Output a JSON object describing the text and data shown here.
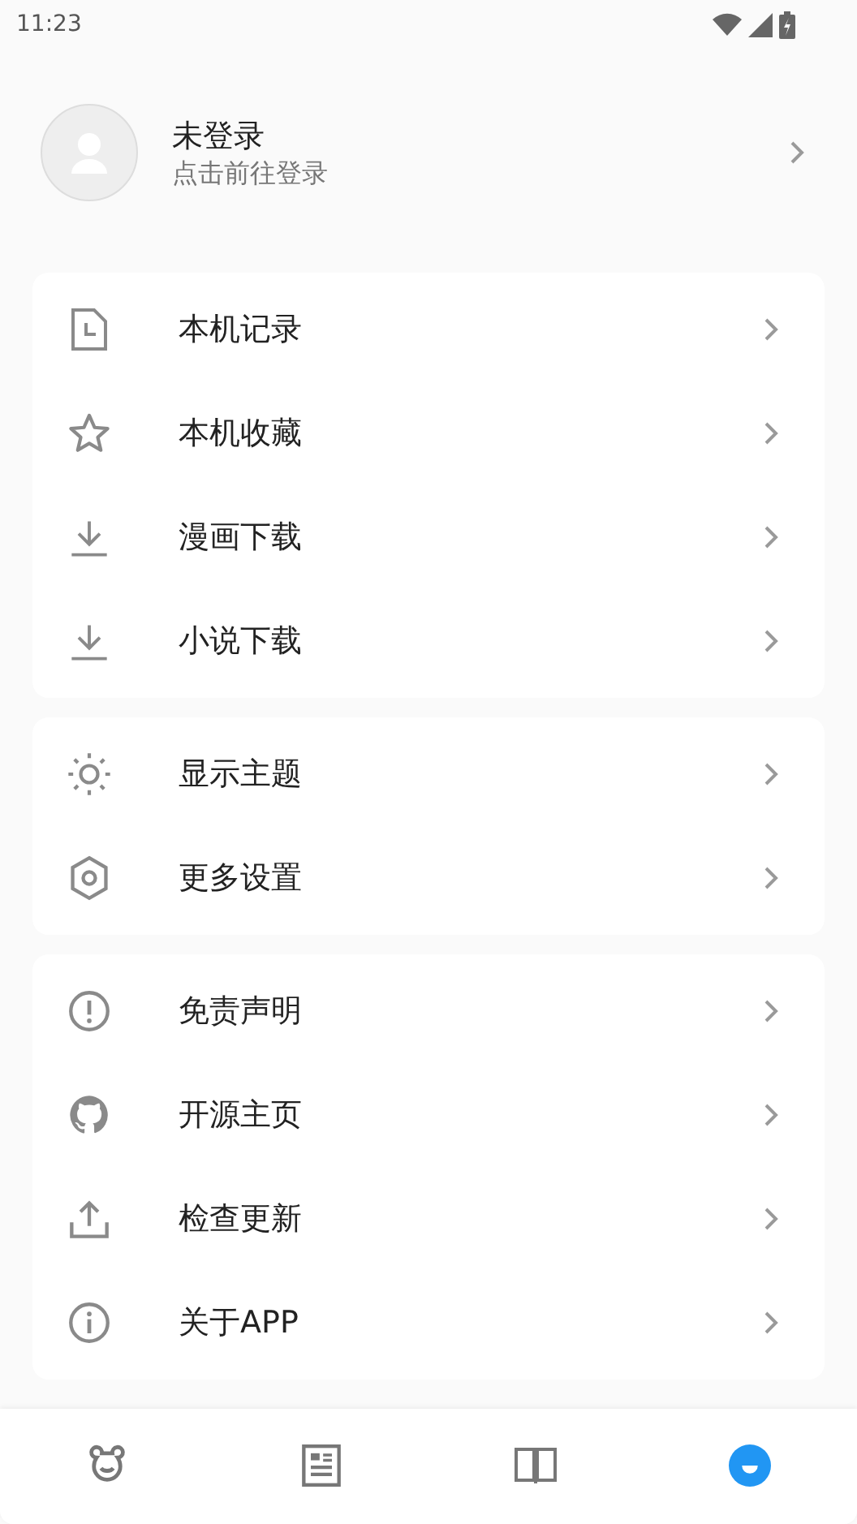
{
  "status_bar": {
    "time": "11:23"
  },
  "profile": {
    "name": "未登录",
    "hint": "点击前往登录"
  },
  "menu_groups": [
    {
      "items": [
        {
          "label": "本机记录"
        },
        {
          "label": "本机收藏"
        },
        {
          "label": "漫画下载"
        },
        {
          "label": "小说下载"
        }
      ]
    },
    {
      "items": [
        {
          "label": "显示主题"
        },
        {
          "label": "更多设置"
        }
      ]
    },
    {
      "items": [
        {
          "label": "免责声明"
        },
        {
          "label": "开源主页"
        },
        {
          "label": "检查更新"
        },
        {
          "label": "关于APP"
        }
      ]
    }
  ],
  "bottom_nav": [
    {
      "selected": false
    },
    {
      "selected": false
    },
    {
      "selected": false
    },
    {
      "selected": true
    }
  ]
}
